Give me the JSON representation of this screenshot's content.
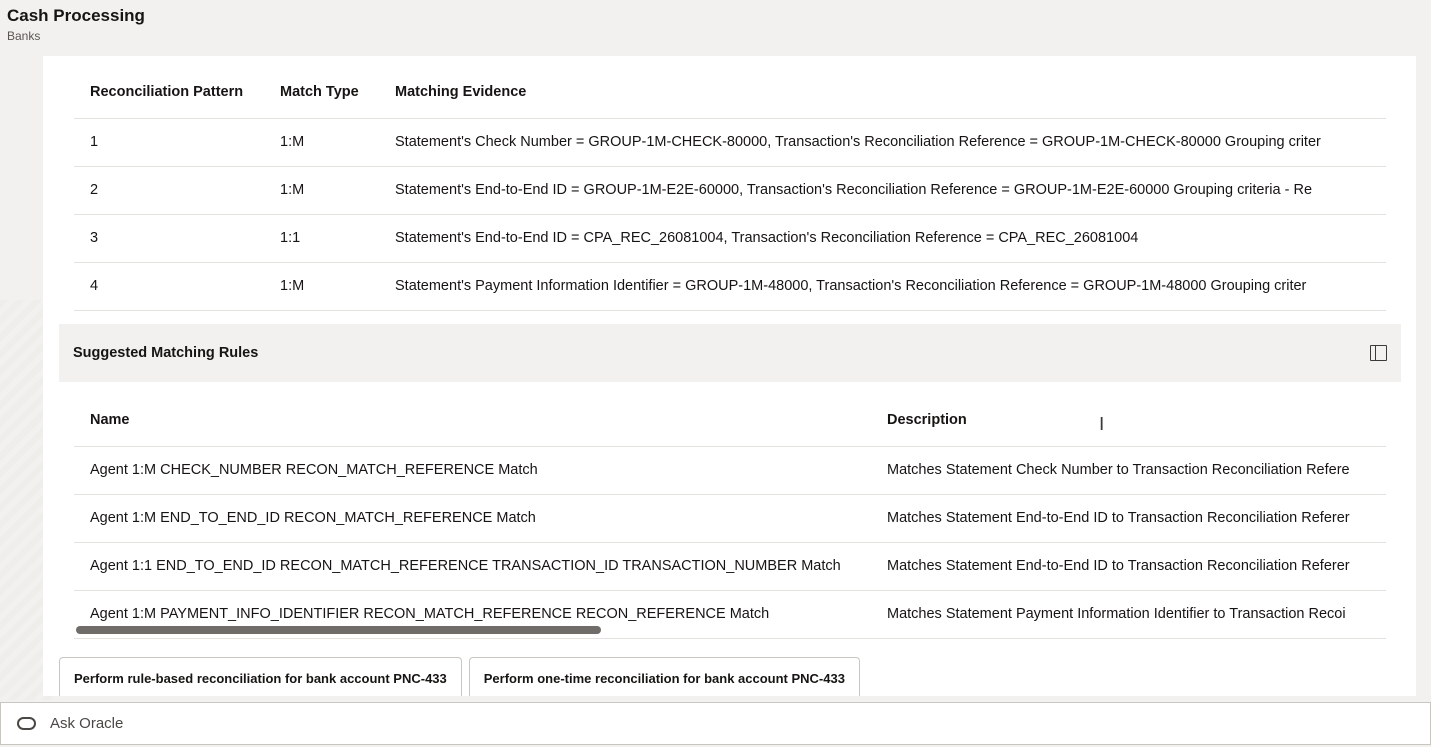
{
  "header": {
    "title": "Cash Processing",
    "subtitle": "Banks"
  },
  "patterns_table": {
    "columns": [
      "Reconciliation Pattern",
      "Match Type",
      "Matching Evidence"
    ],
    "rows": [
      [
        "1",
        "1:M",
        "Statement's Check Number = GROUP-1M-CHECK-80000, Transaction's Reconciliation Reference = GROUP-1M-CHECK-80000 Grouping criter"
      ],
      [
        "2",
        "1:M",
        "Statement's End-to-End ID = GROUP-1M-E2E-60000, Transaction's Reconciliation Reference = GROUP-1M-E2E-60000 Grouping criteria - Re"
      ],
      [
        "3",
        "1:1",
        "Statement's End-to-End ID = CPA_REC_26081004, Transaction's Reconciliation Reference = CPA_REC_26081004"
      ],
      [
        "4",
        "1:M",
        "Statement's Payment Information Identifier = GROUP-1M-48000, Transaction's Reconciliation Reference = GROUP-1M-48000 Grouping criter"
      ]
    ]
  },
  "rules_section": {
    "title": "Suggested Matching Rules",
    "icon": "panel-toggle-icon"
  },
  "rules_table": {
    "columns": [
      "Name",
      "Description"
    ],
    "rows": [
      [
        "Agent 1:M CHECK_NUMBER RECON_MATCH_REFERENCE Match",
        "Matches Statement Check Number to Transaction Reconciliation Refere"
      ],
      [
        "Agent 1:M END_TO_END_ID RECON_MATCH_REFERENCE Match",
        "Matches Statement End-to-End ID to Transaction Reconciliation Referer"
      ],
      [
        "Agent 1:1 END_TO_END_ID RECON_MATCH_REFERENCE TRANSACTION_ID TRANSACTION_NUMBER Match",
        "Matches Statement End-to-End ID to Transaction Reconciliation Referer"
      ],
      [
        "Agent 1:M PAYMENT_INFO_IDENTIFIER RECON_MATCH_REFERENCE RECON_REFERENCE Match",
        "Matches Statement Payment Information Identifier to Transaction Recoi"
      ]
    ]
  },
  "actions": {
    "rule_based": "Perform rule-based reconciliation for bank account PNC-433",
    "one_time": "Perform one-time reconciliation for bank account PNC-433"
  },
  "ask_bar": {
    "placeholder": "Ask Oracle",
    "icon": "oracle-icon"
  }
}
